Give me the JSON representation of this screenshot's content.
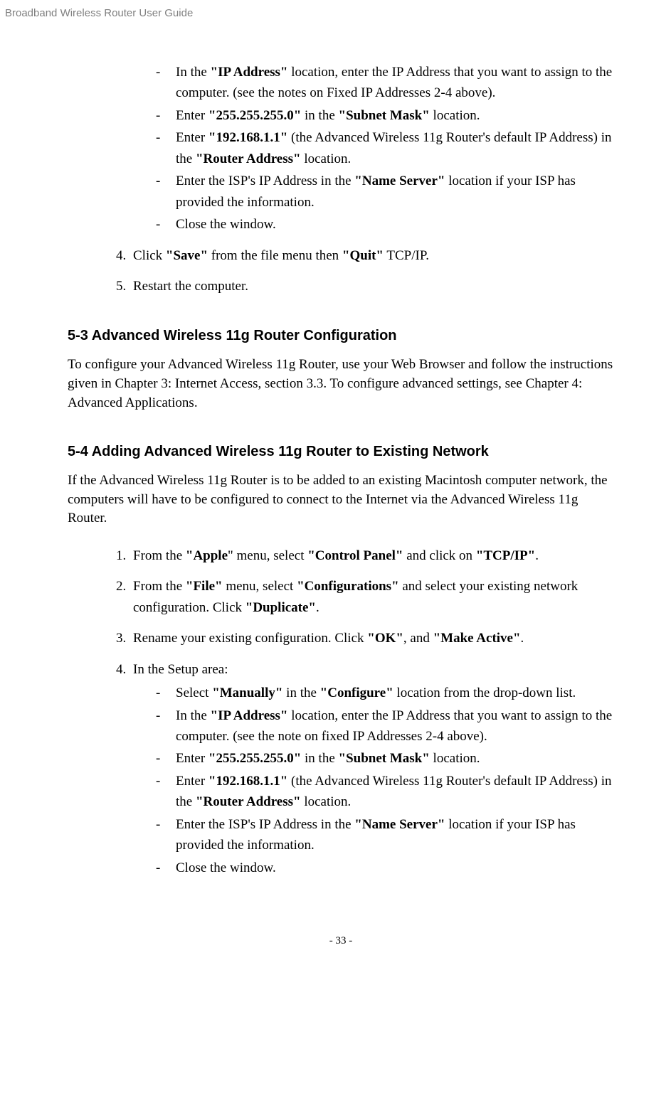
{
  "header": "Broadband Wireless Router User Guide",
  "top_sub": {
    "ip_pre": "In the ",
    "ip_b": "\"IP Address\"",
    "ip_post": " location, enter the IP Address that you want to assign to the computer. (see the notes on Fixed IP Addresses 2-4 above).",
    "subnet_pre": "Enter ",
    "subnet_val": "\"255.255.255.0\"",
    "subnet_mid": " in the ",
    "subnet_lbl": "\"Subnet Mask\"",
    "subnet_post": " location.",
    "router_pre": "Enter ",
    "router_val": "\"192.168.1.1\"",
    "router_mid": " (the Advanced Wireless 11g Router's default IP Address) in the ",
    "router_lbl": "\"Router Address\"",
    "router_post": " location.",
    "ns_pre": "Enter the ISP's IP Address in the ",
    "ns_lbl": "\"Name Server\"",
    "ns_post": " location if your ISP has provided the information.",
    "close": "Close the window."
  },
  "step4": {
    "num": "4.",
    "pre": "Click ",
    "b1": "\"Save\"",
    "mid": " from the file menu then ",
    "b2": "\"Quit\"",
    "post": " TCP/IP."
  },
  "step5": {
    "num": "5.",
    "text": "Restart the computer."
  },
  "sec53": {
    "heading": "5-3 Advanced Wireless 11g Router Configuration",
    "para": "To configure your Advanced Wireless 11g Router, use your Web Browser and follow the instructions given in Chapter 3: Internet Access, section 3.3. To configure advanced settings, see Chapter 4: Advanced Applications."
  },
  "sec54": {
    "heading": "5-4 Adding Advanced Wireless 11g Router to Existing Network",
    "para": "If the Advanced Wireless 11g Router is to be added to an existing Macintosh computer network, the computers will have to be configured to connect to the Internet via the Advanced Wireless 11g Router."
  },
  "s54_1": {
    "num": "1.",
    "pre": "From the ",
    "b1": "\"Apple",
    "mid1": "\" menu, select ",
    "b2": "\"Control Panel\"",
    "mid2": " and click on ",
    "b3": "\"TCP/IP\"",
    "post": "."
  },
  "s54_2": {
    "num": "2.",
    "pre": "From the ",
    "b1": "\"File\"",
    "mid1": " menu, select ",
    "b2": "\"Configurations\"",
    "mid2": " and select your existing network configuration. Click ",
    "b3": "\"Duplicate\"",
    "post": "."
  },
  "s54_3": {
    "num": "3.",
    "pre": "Rename your existing configuration. Click ",
    "b1": "\"OK\"",
    "mid": ", and ",
    "b2": "\"Make Active\"",
    "post": "."
  },
  "s54_4": {
    "num": "4.",
    "intro": "In the Setup area:",
    "sub": {
      "cfg_pre": "Select ",
      "cfg_b1": "\"Manually\"",
      "cfg_mid": " in the ",
      "cfg_b2": "\"Configure\"",
      "cfg_post": " location from the drop-down list.",
      "ip_pre": "In the ",
      "ip_b": "\"IP Address\"",
      "ip_post": " location, enter the IP Address that you want to assign to the computer. (see the note on fixed IP Addresses 2-4 above).",
      "subnet_pre": "Enter ",
      "subnet_val": "\"255.255.255.0\"",
      "subnet_mid": " in the ",
      "subnet_lbl": "\"Subnet Mask\"",
      "subnet_post": " location.",
      "router_pre": "Enter ",
      "router_val": "\"192.168.1.1\"",
      "router_mid": " (the Advanced Wireless 11g Router's default IP Address) in the ",
      "router_lbl": "\"Router Address\"",
      "router_post": " location.",
      "ns_pre": "Enter the ISP's IP Address in the ",
      "ns_lbl": "\"Name Server\"",
      "ns_post": " location if your ISP has provided the information.",
      "close": "Close the window."
    }
  },
  "footer": "- 33 -"
}
